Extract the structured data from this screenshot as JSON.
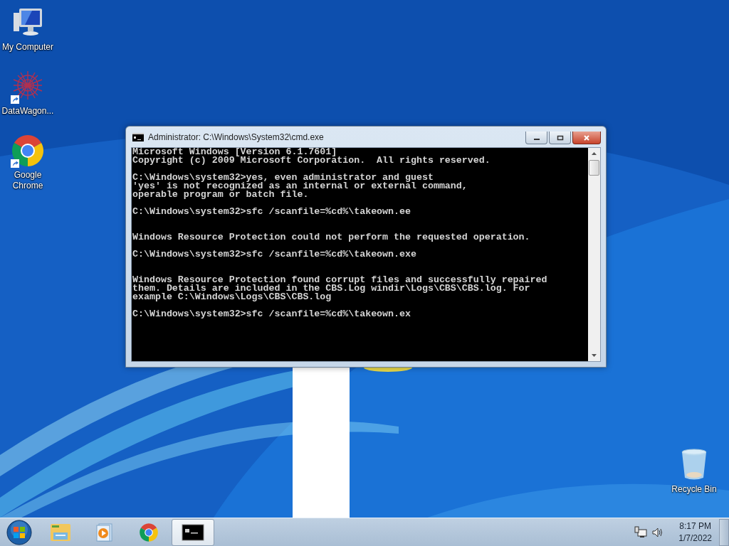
{
  "desktop_icons": [
    {
      "label": "My Computer",
      "kind": "computer",
      "shortcut": false
    },
    {
      "label": "DataWagon...",
      "kind": "starburst",
      "shortcut": true
    },
    {
      "label": "Google Chrome",
      "kind": "chrome",
      "shortcut": true
    }
  ],
  "recycle_bin": {
    "label": "Recycle Bin"
  },
  "window": {
    "title": "Administrator: C:\\Windows\\System32\\cmd.exe",
    "console": [
      {
        "kind": "output",
        "lines": [
          "Microsoft Windows [Version 6.1.7601]",
          "Copyright (c) 2009 Microsoft Corporation.  All rights reserved."
        ]
      },
      {
        "kind": "output",
        "lines": [
          "C:\\Windows\\system32>yes, even administrator and guest",
          "'yes' is not recognized as an internal or external command,",
          "operable program or batch file."
        ]
      },
      {
        "kind": "output",
        "lines": [
          "C:\\Windows\\system32>sfc /scanfile=%cd%\\takeown.ee"
        ]
      },
      {
        "kind": "sfc-result",
        "lines": [
          "Windows Resource Protection could not perform the requested operation."
        ]
      },
      {
        "kind": "output",
        "lines": [
          "C:\\Windows\\system32>sfc /scanfile=%cd%\\takeown.exe"
        ]
      },
      {
        "kind": "sfc-result",
        "lines": [
          "Windows Resource Protection found corrupt files and successfully repaired",
          "them. Details are included in the CBS.Log windir\\Logs\\CBS\\CBS.log. For",
          "example C:\\Windows\\Logs\\CBS\\CBS.log"
        ]
      },
      {
        "kind": "output",
        "lines": [
          "C:\\Windows\\system32>sfc /scanfile=%cd%\\takeown.ex"
        ]
      }
    ]
  },
  "taskbar": {
    "apps": [
      {
        "kind": "explorer",
        "selected": false
      },
      {
        "kind": "media-player",
        "selected": false
      },
      {
        "kind": "chrome",
        "selected": false
      },
      {
        "kind": "console",
        "selected": true
      }
    ],
    "clock": {
      "time": "8:17 PM",
      "date": "1/7/2022"
    }
  }
}
